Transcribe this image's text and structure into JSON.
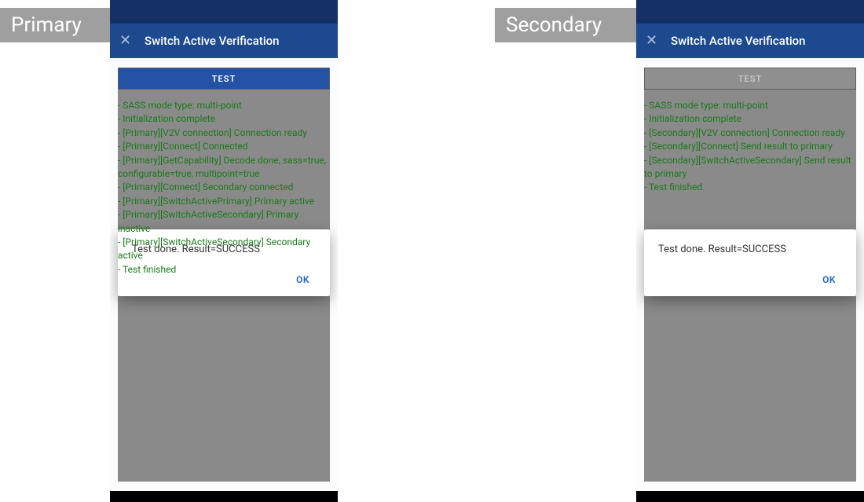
{
  "captions": {
    "primary": "Primary",
    "secondary": "Secondary"
  },
  "colors": {
    "statusbar": "#143065",
    "appbar": "#1d4a8f",
    "button": "#2452a6",
    "log_text": "#1a7a1a",
    "dialog_action": "#1e66d0"
  },
  "primary": {
    "appbar": {
      "close_glyph": "✕",
      "title": "Switch Active Verification"
    },
    "test_button": {
      "label": "TEST",
      "enabled": true
    },
    "log_lines": [
      "- SASS mode type: multi-point",
      "- Initialization complete",
      "- [Primary][V2V connection] Connection ready",
      "- [Primary][Connect] Connected",
      "- [Primary][GetCapability] Decode done, sass=true, configurable=true, multipoint=true",
      "- [Primary][Connect] Secondary connected",
      "- [Primary][SwitchActivePrimary] Primary active",
      "- [Primary][SwitchActiveSecondary] Primary inactive",
      "- [Primary][SwitchActiveSecondary] Secondary active",
      "- Test finished"
    ],
    "dialog": {
      "message": "Test done. Result=SUCCESS",
      "ok_label": "OK"
    }
  },
  "secondary": {
    "appbar": {
      "close_glyph": "✕",
      "title": "Switch Active Verification"
    },
    "test_button": {
      "label": "TEST",
      "enabled": false
    },
    "log_lines": [
      "- SASS mode type: multi-point",
      "- Initialization complete",
      "- [Secondary][V2V connection] Connection ready",
      "- [Secondary][Connect] Send result to primary",
      "- [Secondary][SwitchActiveSecondary] Send result to primary",
      "- Test finished"
    ],
    "dialog": {
      "message": "Test done. Result=SUCCESS",
      "ok_label": "OK"
    }
  }
}
